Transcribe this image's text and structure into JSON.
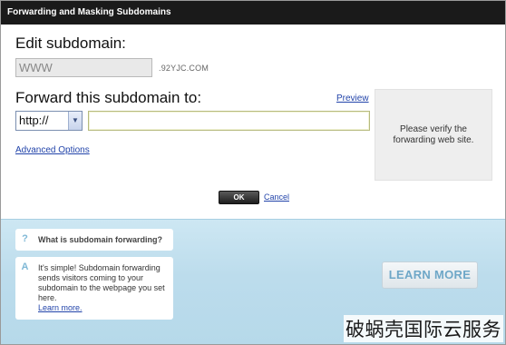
{
  "dialog": {
    "title": "Forwarding and Masking Subdomains"
  },
  "edit": {
    "label": "Edit subdomain:",
    "subdomain_value": "WWW",
    "domain_suffix": ".92YJC.COM"
  },
  "forward": {
    "label": "Forward this subdomain to:",
    "preview_label": "Preview",
    "protocol_selected": "http://",
    "url_value": "",
    "verify_text": "Please verify the forwarding web site."
  },
  "advanced_label": "Advanced Options",
  "actions": {
    "ok_label": "OK",
    "cancel_label": "Cancel"
  },
  "help": {
    "question": "What is subdomain forwarding?",
    "answer": "It's simple! Subdomain forwarding sends visitors coming to your subdomain to the webpage you set here.",
    "answer_link": "Learn more.",
    "learn_more_button": "LEARN MORE",
    "q_icon": "?",
    "a_icon": "A"
  },
  "watermark": "破蜗壳国际云服务"
}
